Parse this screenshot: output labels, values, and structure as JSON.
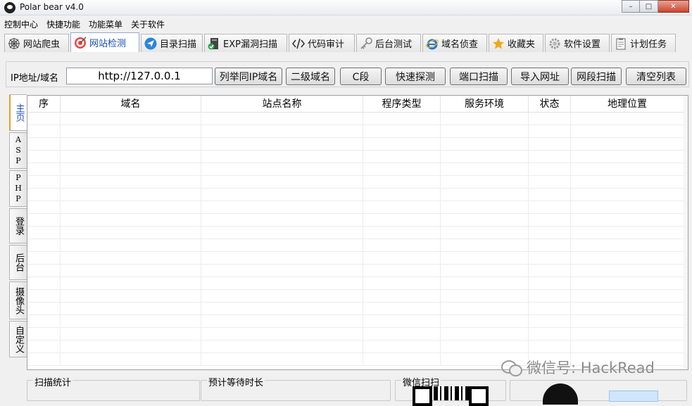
{
  "window": {
    "title": "Polar bear v4.0",
    "controls": [
      "–",
      "□",
      "✕"
    ]
  },
  "menu": [
    "控制中心",
    "快捷功能",
    "功能菜单",
    "关于软件"
  ],
  "tabs": [
    {
      "label": "网站爬虫",
      "icon": "spider-web-icon"
    },
    {
      "label": "网站检测",
      "icon": "target-icon",
      "active": true
    },
    {
      "label": "目录扫描",
      "icon": "send-arrow-icon"
    },
    {
      "label": "EXP漏洞扫描",
      "icon": "server-shield-icon"
    },
    {
      "label": "代码审计",
      "icon": "code-brackets-icon"
    },
    {
      "label": "后台测试",
      "icon": "key-icon"
    },
    {
      "label": "域名侦查",
      "icon": "ie-browser-icon"
    },
    {
      "label": "收藏夹",
      "icon": "star-icon"
    },
    {
      "label": "软件设置",
      "icon": "gear-icon"
    },
    {
      "label": "计划任务",
      "icon": "clipboard-icon"
    }
  ],
  "query": {
    "label": "IP地址/域名",
    "value": "http://127.0.0.1",
    "buttons": [
      "列举同IP域名",
      "二级域名",
      "C段",
      "快速探测",
      "端口扫描",
      "导入网址",
      "网段扫描",
      "清空列表"
    ]
  },
  "side_tabs": [
    "主页",
    "ASP",
    "PHP",
    "登录",
    "后台",
    "摄像头",
    "自定义"
  ],
  "table": {
    "columns": [
      "序",
      "域名",
      "站点名称",
      "程序类型",
      "服务环境",
      "状态",
      "地理位置"
    ],
    "rows": []
  },
  "bottom": {
    "scan_stats_label": "扫描统计",
    "wait_time_label": "预计等待时长",
    "wechat_label": "微信扫扫"
  },
  "watermark": "微信号: HackRead",
  "colors": {
    "active_tab_text": "#1a4fb5",
    "active_side_accent": "#e59b2b"
  }
}
